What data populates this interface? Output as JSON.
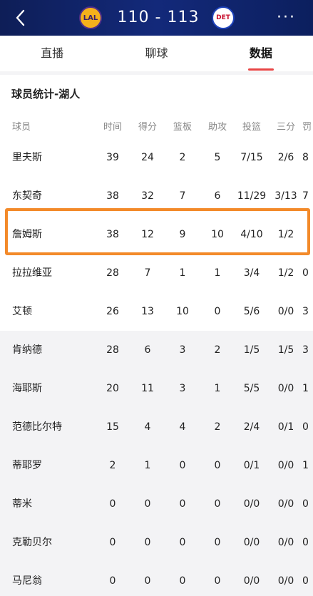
{
  "header": {
    "home_logo": "LAL",
    "away_logo": "DET",
    "home_score": "110",
    "separator": "-",
    "away_score": "113",
    "more_label": "···"
  },
  "tabs": [
    {
      "label": "直播",
      "active": false
    },
    {
      "label": "聊球",
      "active": false
    },
    {
      "label": "数据",
      "active": true
    }
  ],
  "section": {
    "title": "球员统计-湖人"
  },
  "columns": [
    "球员",
    "时间",
    "得分",
    "篮板",
    "助攻",
    "投篮",
    "三分",
    "罚"
  ],
  "players": [
    {
      "name": "里夫斯",
      "min": "39",
      "pts": "24",
      "reb": "2",
      "ast": "5",
      "fg": "7/15",
      "tp": "2/6",
      "ft": "8"
    },
    {
      "name": "东契奇",
      "min": "38",
      "pts": "32",
      "reb": "7",
      "ast": "6",
      "fg": "11/29",
      "tp": "3/13",
      "ft": "7"
    },
    {
      "name": "詹姆斯",
      "min": "38",
      "pts": "12",
      "reb": "9",
      "ast": "10",
      "fg": "4/10",
      "tp": "1/2",
      "ft": ""
    },
    {
      "name": "拉拉维亚",
      "min": "28",
      "pts": "7",
      "reb": "1",
      "ast": "1",
      "fg": "3/4",
      "tp": "1/2",
      "ft": "0"
    },
    {
      "name": "艾顿",
      "min": "26",
      "pts": "13",
      "reb": "10",
      "ast": "0",
      "fg": "5/6",
      "tp": "0/0",
      "ft": "3"
    },
    {
      "name": "肯纳德",
      "min": "28",
      "pts": "6",
      "reb": "3",
      "ast": "2",
      "fg": "1/5",
      "tp": "1/5",
      "ft": "3"
    },
    {
      "name": "海耶斯",
      "min": "20",
      "pts": "11",
      "reb": "3",
      "ast": "1",
      "fg": "5/5",
      "tp": "0/0",
      "ft": "1"
    },
    {
      "name": "范德比尔特",
      "min": "15",
      "pts": "4",
      "reb": "4",
      "ast": "2",
      "fg": "2/4",
      "tp": "0/1",
      "ft": "0"
    },
    {
      "name": "蒂耶罗",
      "min": "2",
      "pts": "1",
      "reb": "0",
      "ast": "0",
      "fg": "0/1",
      "tp": "0/0",
      "ft": "1"
    },
    {
      "name": "蒂米",
      "min": "0",
      "pts": "0",
      "reb": "0",
      "ast": "0",
      "fg": "0/0",
      "tp": "0/0",
      "ft": "0"
    },
    {
      "name": "克勒贝尔",
      "min": "0",
      "pts": "0",
      "reb": "0",
      "ast": "0",
      "fg": "0/0",
      "tp": "0/0",
      "ft": "0"
    },
    {
      "name": "马尼翁",
      "min": "0",
      "pts": "0",
      "reb": "0",
      "ast": "0",
      "fg": "0/0",
      "tp": "0/0",
      "ft": "0"
    }
  ],
  "colors": {
    "header_bg": "#13297a",
    "accent": "#e84545",
    "highlight": "#f38a2a",
    "lal_gold": "#f5b11b",
    "det_red": "#c8102e"
  }
}
